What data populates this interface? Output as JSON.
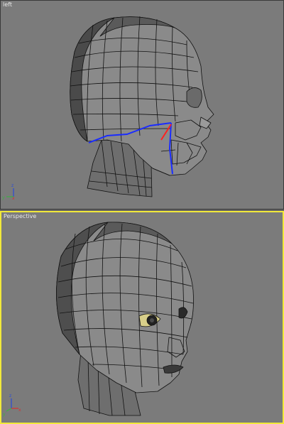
{
  "viewports": {
    "left": {
      "label": "left",
      "axes": {
        "vertical": "z",
        "horizontal": "y"
      }
    },
    "perspective": {
      "label": "Perspective",
      "axes": {
        "vertical": "z",
        "horizontal": "x"
      },
      "active": true
    }
  },
  "colors": {
    "viewport_bg": "#7b7b7b",
    "active_border": "#f2e93a",
    "mesh_fill": "#8a8a8a",
    "mesh_dark": "#3a3a3a",
    "edge_line": "#111111",
    "selected_edges": "#1a2cff",
    "highlight_edge": "#ff2020",
    "axis_z": "#2b4bd8",
    "axis_y": "#3cb043",
    "axis_x": "#d83030"
  },
  "icons": {
    "axis_tripod": "axis-tripod-icon"
  }
}
